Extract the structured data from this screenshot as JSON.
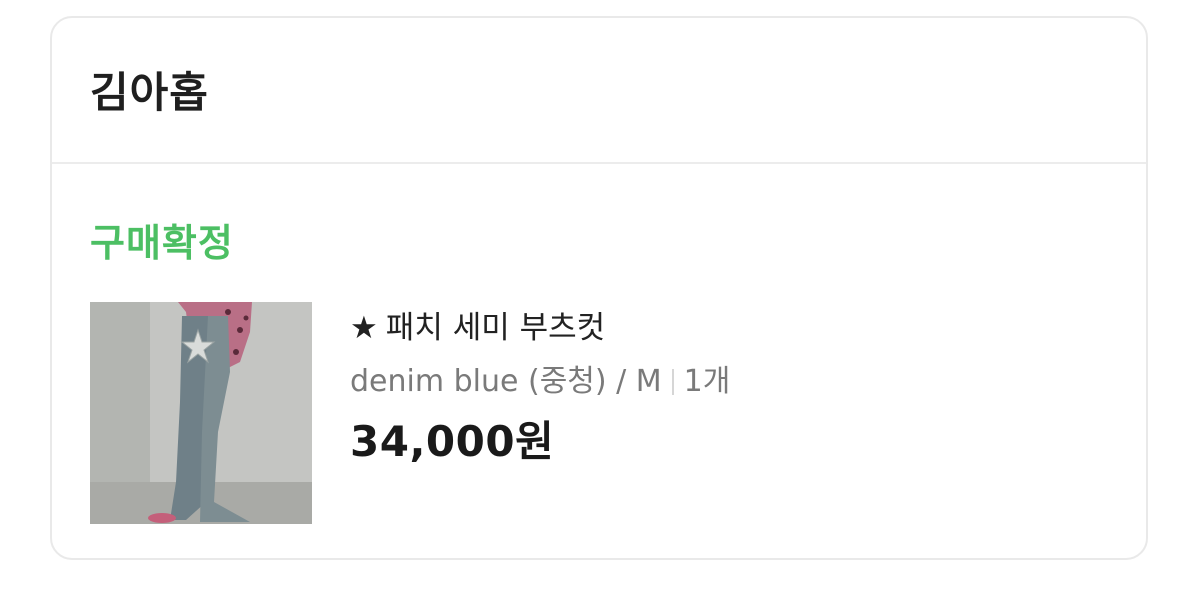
{
  "store": {
    "name": "김아홉"
  },
  "order": {
    "status": "구매확정",
    "status_color": "#4cbf63"
  },
  "product": {
    "image_alt": "product-photo-denim-jeans",
    "star_icon": "★",
    "title": "패치 세미 부츠컷",
    "option": "denim blue (중청) / M",
    "quantity": "1개",
    "price": "34,000원"
  }
}
